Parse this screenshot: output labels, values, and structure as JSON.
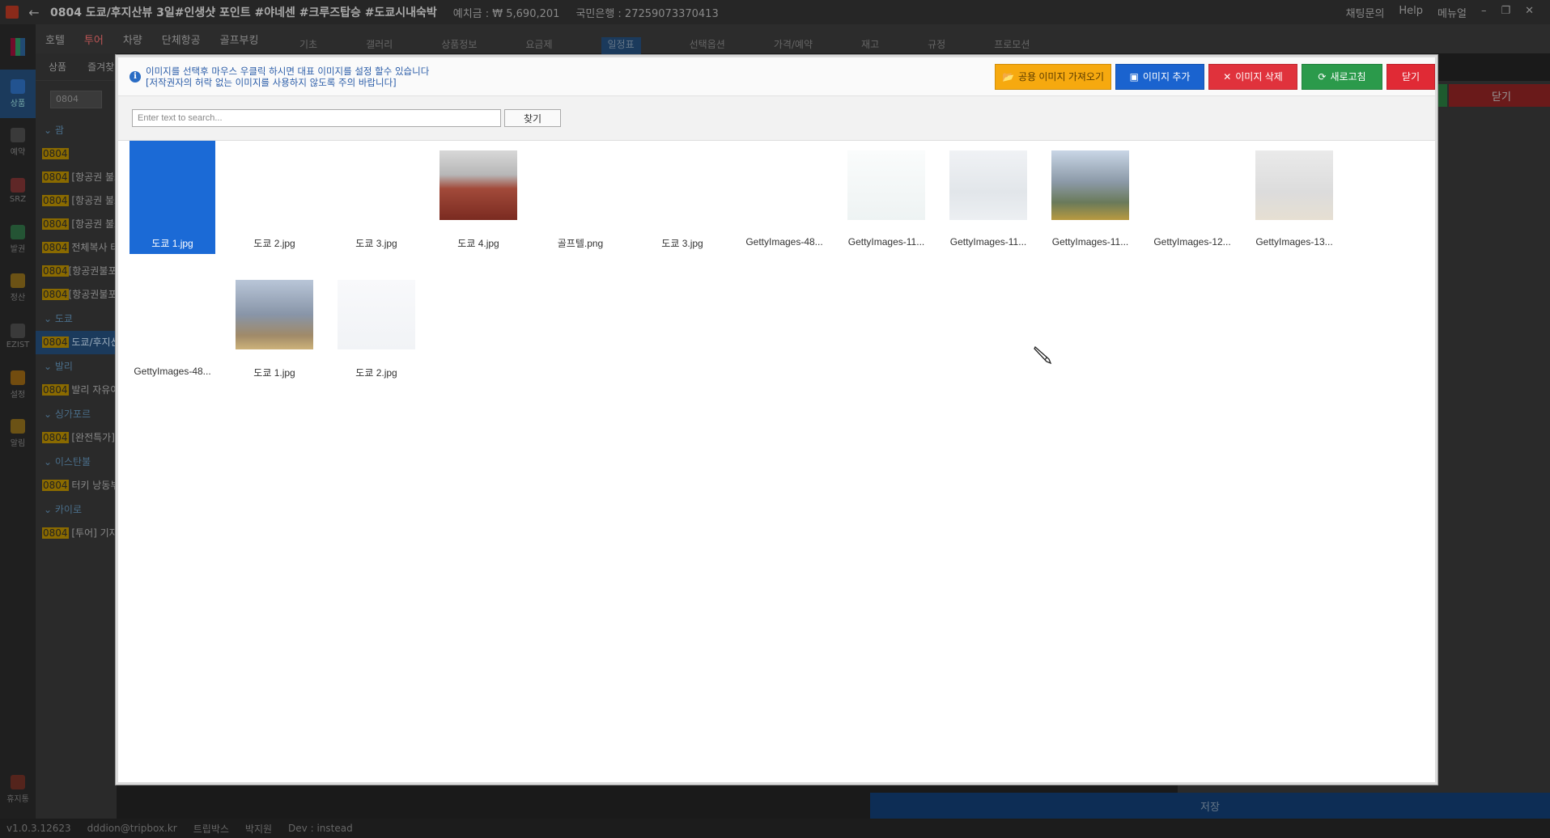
{
  "app": {
    "title": "0804 도쿄/후지산뷰 3일#인생샷 포인트 #야네센 #크루즈탑승 #도쿄시내숙박",
    "deposit": "예치금 : ₩ 5,690,201",
    "bank": "국민은행 : 27259073370413",
    "top_right": [
      "채팅문의",
      "Help",
      "메뉴얼"
    ],
    "menu": [
      "호텔",
      "투어",
      "차량",
      "단체항공",
      "골프부킹"
    ],
    "tabs": [
      "기초",
      "갤러리",
      "상품정보",
      "요금제",
      "일정표",
      "선택옵션",
      "가격/예약",
      "재고",
      "규정",
      "프로모션"
    ],
    "left_icons": [
      {
        "label": "상품",
        "active": true
      },
      {
        "label": "예약",
        "active": false
      },
      {
        "label": "SRZ",
        "active": false
      },
      {
        "label": "발권",
        "active": false
      },
      {
        "label": "정산",
        "active": false
      },
      {
        "label": "EZIST",
        "active": false
      },
      {
        "label": "설정",
        "active": false
      },
      {
        "label": "알림",
        "active": false
      }
    ],
    "trash_label": "휴지통",
    "list_subtabs": [
      "상품",
      "즐겨찾"
    ],
    "list_search": "0804",
    "list": [
      {
        "type": "sec",
        "text": "⌄ 괌"
      },
      {
        "type": "row",
        "code": "0804",
        "text": ""
      },
      {
        "type": "row",
        "code": "0804",
        "text": " [항공권 불포"
      },
      {
        "type": "row",
        "code": "0804",
        "text": " [항공권 불포"
      },
      {
        "type": "row",
        "code": "0804",
        "text": " [항공권 불포"
      },
      {
        "type": "row",
        "code": "0804",
        "text": " 전체복사 테"
      },
      {
        "type": "row",
        "code": "0804",
        "text": "[항공권불포"
      },
      {
        "type": "row",
        "code": "0804",
        "text": "[항공권불포"
      },
      {
        "type": "sec",
        "text": "⌄ 도쿄"
      },
      {
        "type": "row",
        "code": "0804",
        "text": " 도쿄/후지산",
        "sel": true
      },
      {
        "type": "sec",
        "text": "⌄ 발리"
      },
      {
        "type": "row",
        "code": "0804",
        "text": " 발리 자유여"
      },
      {
        "type": "sec",
        "text": "⌄ 싱가포르"
      },
      {
        "type": "row",
        "code": "0804",
        "text": " [완전특가]"
      },
      {
        "type": "sec",
        "text": "⌄ 이스탄불"
      },
      {
        "type": "row",
        "code": "0804",
        "text": " 터키 낭동부"
      },
      {
        "type": "sec",
        "text": "⌄ 카이로"
      },
      {
        "type": "row",
        "code": "0804",
        "text": " [투어] 기자"
      }
    ],
    "right_close": "닫기",
    "save": "저장",
    "status": [
      "v1.0.3.12623",
      "dddion@tripbox.kr",
      "트립박스",
      "박지원",
      "Dev : instead"
    ]
  },
  "modal": {
    "notice_line1": "이미지를 선택후 마우스 우클릭 하시면 대표 이미지를 설정 할수 있습니다",
    "notice_line2": "[저작권자의 허락 없는 이미지를 사용하지 않도록 주의 바랍니다]",
    "buttons": {
      "shared": "공용 이미지 가져오기",
      "add": "이미지 추가",
      "delete": "이미지 삭제",
      "refresh": "새로고침",
      "close": "닫기"
    },
    "search_placeholder": "Enter text to search...",
    "search_button": "찾기",
    "images": [
      {
        "name": "도쿄 1.jpg",
        "thumb": "none",
        "selected": true
      },
      {
        "name": "도쿄 2.jpg",
        "thumb": "none"
      },
      {
        "name": "도쿄 3.jpg",
        "thumb": "none"
      },
      {
        "name": "도쿄 4.jpg",
        "thumb": "red"
      },
      {
        "name": "골프텔.png",
        "thumb": "none"
      },
      {
        "name": "도쿄 3.jpg",
        "thumb": "none"
      },
      {
        "name": "GettyImages-48...",
        "thumb": "none"
      },
      {
        "name": "GettyImages-11...",
        "thumb": "faint1"
      },
      {
        "name": "GettyImages-11...",
        "thumb": "faint2"
      },
      {
        "name": "GettyImages-11...",
        "thumb": "park"
      },
      {
        "name": "GettyImages-12...",
        "thumb": "none"
      },
      {
        "name": "GettyImages-13...",
        "thumb": "tower-faint"
      },
      {
        "name": "GettyImages-48...",
        "thumb": "none"
      },
      {
        "name": "도쿄 1.jpg",
        "thumb": "tower"
      },
      {
        "name": "도쿄 2.jpg",
        "thumb": "faint3"
      }
    ]
  }
}
